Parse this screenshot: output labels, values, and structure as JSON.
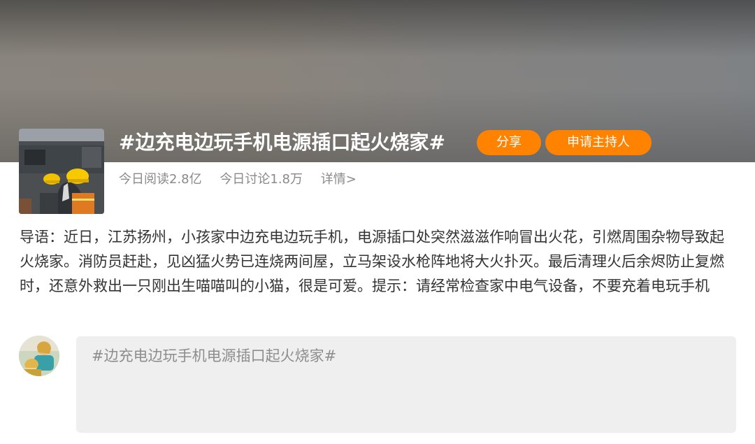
{
  "topic": {
    "title": "#边充电边玩手机电源插口起火烧家#",
    "share_label": "分享",
    "host_label": "申请主持人",
    "stats": {
      "reads": "今日阅读2.8亿",
      "discussions": "今日讨论1.8万",
      "details": "详情>"
    }
  },
  "intro": {
    "text": "导语：近日，江苏扬州，小孩家中边充电边玩手机，电源插口处突然滋滋作响冒出火花，引燃周围杂物导致起火烧家。消防员赶赴，见凶猛火势已连烧两间屋，立马架设水枪阵地将大火扑灭。最后清理火后余烬防止复燃时，还意外救出一只刚出生喵喵叫的小猫，很是可爱。提示：请经常检查家中电气设备，不要充着电玩手机"
  },
  "composer": {
    "text": "#边充电边玩手机电源插口起火烧家#"
  },
  "colors": {
    "accent": "#ff8200",
    "composer_bg": "#efefef"
  }
}
